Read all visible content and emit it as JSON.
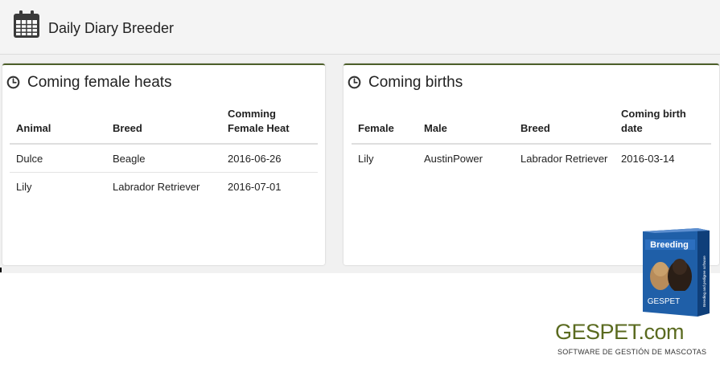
{
  "header": {
    "title": "Daily Diary Breeder",
    "icon": "calendar-icon"
  },
  "heats": {
    "title": "Coming female heats",
    "icon": "clock-icon",
    "columns": [
      "Animal",
      "Breed",
      "Comming Female Heat"
    ],
    "rows": [
      [
        "Dulce",
        "Beagle",
        "2016-06-26"
      ],
      [
        "Lily",
        "Labrador Retriever",
        "2016-07-01"
      ]
    ]
  },
  "births": {
    "title": "Coming births",
    "icon": "clock-icon",
    "columns": [
      "Female",
      "Male",
      "Breed",
      "Coming birth date"
    ],
    "rows": [
      [
        "Lily",
        "AustinPower",
        "Labrador Retriever",
        "2016-03-14"
      ]
    ]
  },
  "promo": {
    "box_label": "Breeding",
    "box_brand": "GESPET",
    "box_side_text": "Breeding and pedigree software",
    "logo": "GESPET.com",
    "tagline": "SOFTWARE DE GESTIÓN DE MASCOTAS"
  },
  "colors": {
    "accent": "#4d5f2a",
    "logo": "#5a6a1f",
    "box_blue": "#1f5fa8"
  }
}
